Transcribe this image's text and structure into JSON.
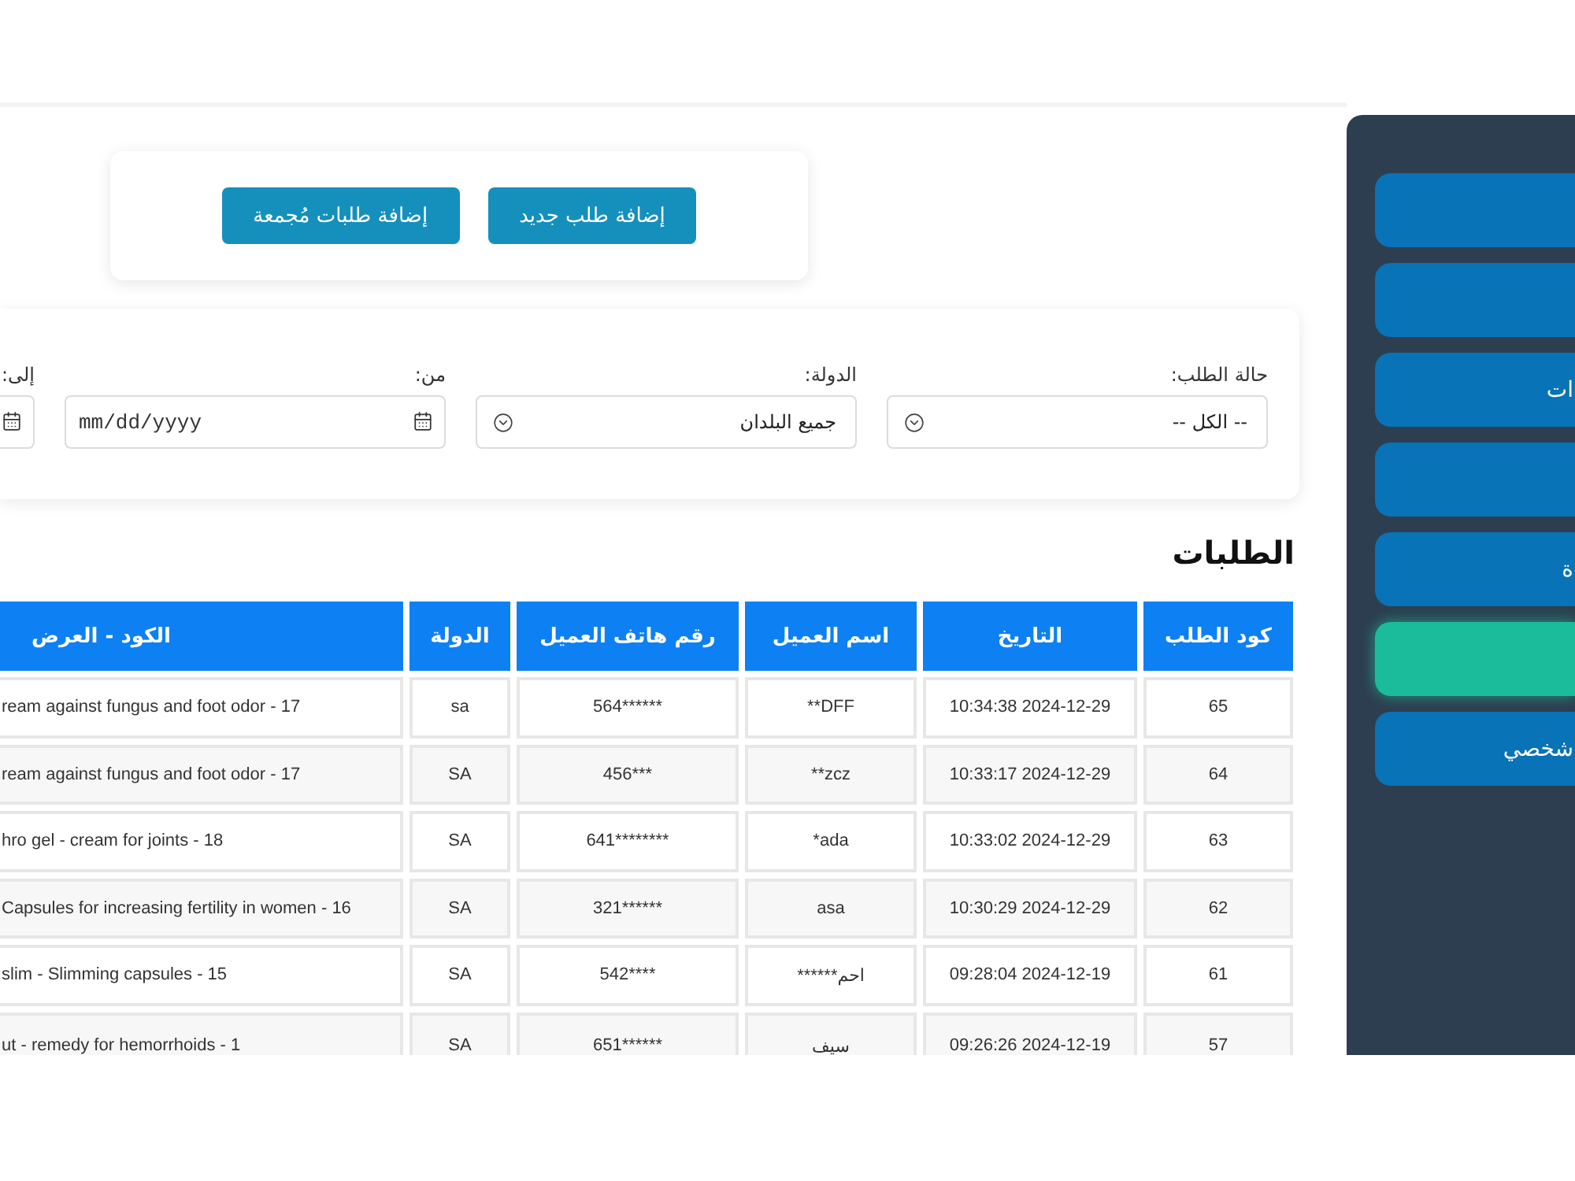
{
  "sidebar": {
    "items": [
      {
        "selected": false
      },
      {
        "selected": false
      },
      {
        "label": "ات",
        "selected": false
      },
      {
        "selected": false
      },
      {
        "label": "ة",
        "selected": false
      },
      {
        "selected": true
      },
      {
        "label": "شخصي",
        "selected": false
      }
    ]
  },
  "actions": {
    "buttons": [
      "إضافة طلب جديد",
      "إضافة طلبات مُجمعة"
    ]
  },
  "filters": [
    {
      "kind": "select",
      "label": "حالة الطلب:",
      "value": "-- الكل --"
    },
    {
      "kind": "select",
      "label": "الدولة:",
      "value": "جميع البلدان"
    },
    {
      "kind": "date",
      "label": "من:",
      "placeholder": "mm/dd/yyyy"
    },
    {
      "kind": "date",
      "label": "إلى:"
    }
  ],
  "orders": {
    "title": "الطلبات",
    "columns": [
      "كود الطلب",
      "التاريخ",
      "اسم العميل",
      "رقم هاتف العميل",
      "الدولة",
      "الكود - العرض"
    ],
    "rows": [
      [
        "65",
        "10:34:38 2024-12-29",
        "**DFF",
        "564******",
        "sa",
        "ream against fungus and foot odor - 17"
      ],
      [
        "64",
        "10:33:17 2024-12-29",
        "**zcz",
        "456***",
        "SA",
        "ream against fungus and foot odor - 17"
      ],
      [
        "63",
        "10:33:02 2024-12-29",
        "*ada",
        "641********",
        "SA",
        "hro gel - cream for joints - 18"
      ],
      [
        "62",
        "10:30:29 2024-12-29",
        "asa",
        "321******",
        "SA",
        "Capsules for increasing fertility in women - 16"
      ],
      [
        "61",
        "09:28:04 2024-12-19",
        "احم******",
        "542****",
        "SA",
        "slim - Slimming capsules - 15"
      ],
      [
        "57",
        "09:26:26 2024-12-19",
        "سيف",
        "651******",
        "SA",
        "ut - remedy for hemorrhoids - 1"
      ]
    ]
  }
}
